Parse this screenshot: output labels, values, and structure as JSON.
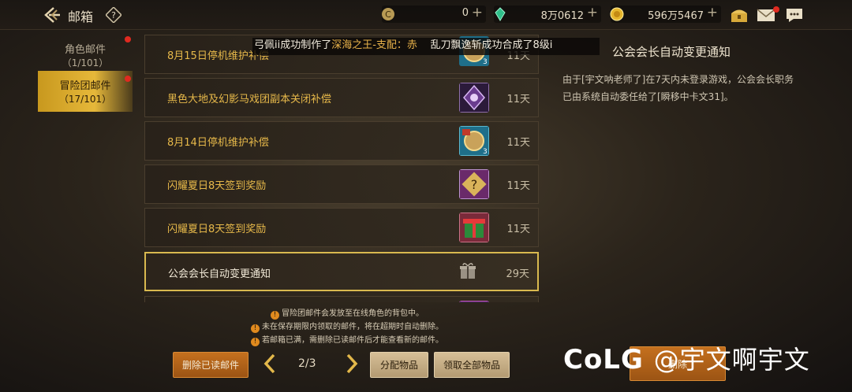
{
  "header": {
    "title": "邮箱",
    "currencies": [
      {
        "icon": "coin-c-icon",
        "value": "0"
      },
      {
        "icon": "gem-icon",
        "value": "8万0612"
      },
      {
        "icon": "gold-coin-icon",
        "value": "596万5467"
      }
    ]
  },
  "tabs": [
    {
      "name": "角色邮件",
      "count": "（1/101）"
    },
    {
      "name": "冒险团邮件",
      "count": "（17/101）"
    }
  ],
  "marquee": {
    "prefix": "弓佩ii成功制作了",
    "highlight": "深海之王-支配：赤",
    "suffix": "    乱刀飘逸斩成功合成了8级i"
  },
  "mails": [
    {
      "title": "8月15日停机维护补偿",
      "days": "11天",
      "icon": "ticket-icon"
    },
    {
      "title": "黑色大地及幻影马戏团副本关闭补偿",
      "days": "11天",
      "icon": "emblem-icon"
    },
    {
      "title": "8月14日停机维护补偿",
      "days": "11天",
      "icon": "ticket-icon"
    },
    {
      "title": "闪耀夏日8天签到奖励",
      "days": "11天",
      "icon": "mystery-box-icon"
    },
    {
      "title": "闪耀夏日8天签到奖励",
      "days": "11天",
      "icon": "gift-box-icon"
    },
    {
      "title": "公会会长自动变更通知",
      "days": "29天",
      "icon": "gift-outline-icon"
    }
  ],
  "detail": {
    "title": "公会会长自动变更通知",
    "body": "由于[宇文呐老师了]在7天内未登录游戏，公会会长职务已由系统自动委任给了[瞬移中卡文31]。"
  },
  "notes": [
    "冒险团邮件会发放至在线角色的背包中。",
    "未在保存期限内领取的邮件，将在超期时自动删除。",
    "若邮箱已满，需删除已读邮件后才能查看新的邮件。"
  ],
  "footer": {
    "delete_read": "删除已读邮件",
    "page": "2/3",
    "distribute": "分配物品",
    "claim_all": "领取全部物品",
    "delete": "删除"
  },
  "watermark": {
    "brand": "CoLG",
    "user": "@宇文啊宇文"
  }
}
